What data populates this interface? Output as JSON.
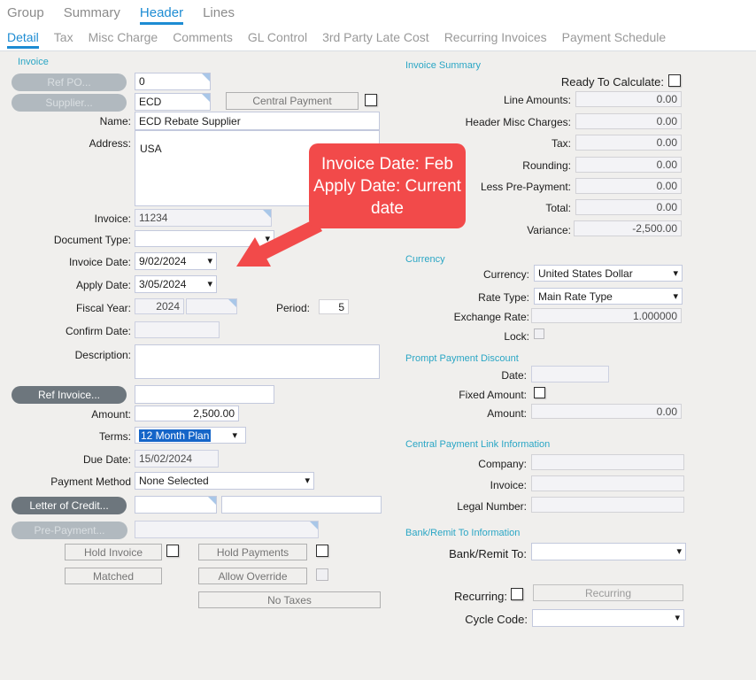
{
  "tabs_top": [
    {
      "label": "Group",
      "active": false
    },
    {
      "label": "Summary",
      "active": false
    },
    {
      "label": "Header",
      "active": true
    },
    {
      "label": "Lines",
      "active": false
    }
  ],
  "tabs_sub": [
    {
      "label": "Detail",
      "active": true
    },
    {
      "label": "Tax",
      "active": false
    },
    {
      "label": "Misc Charge",
      "active": false
    },
    {
      "label": "Comments",
      "active": false
    },
    {
      "label": "GL Control",
      "active": false
    },
    {
      "label": "3rd Party Late Cost",
      "active": false
    },
    {
      "label": "Recurring Invoices",
      "active": false
    },
    {
      "label": "Payment Schedule",
      "active": false
    }
  ],
  "invoice_group": {
    "caption": "Invoice",
    "ref_po_button": "Ref PO...",
    "ref_po_value": "0",
    "supplier_button": "Supplier...",
    "supplier_value": "ECD",
    "central_payment_button": "Central Payment",
    "name_label": "Name:",
    "name_value": "ECD Rebate Supplier",
    "address_label": "Address:",
    "address_value": "USA",
    "invoice_label": "Invoice:",
    "invoice_value": "11234",
    "document_type_label": "Document Type:",
    "document_type_value": "",
    "invoice_date_label": "Invoice Date:",
    "invoice_date_value": "9/02/2024",
    "apply_date_label": "Apply Date:",
    "apply_date_value": "3/05/2024",
    "fiscal_year_label": "Fiscal Year:",
    "fiscal_year_value": "2024",
    "fiscal_suffix_value": "",
    "period_label": "Period:",
    "period_value": "5",
    "confirm_date_label": "Confirm Date:",
    "confirm_date_value": "",
    "description_label": "Description:",
    "description_value": "",
    "ref_invoice_button": "Ref Invoice...",
    "ref_invoice_value": "",
    "amount_label": "Amount:",
    "amount_value": "2,500.00",
    "terms_label": "Terms:",
    "terms_value": "12 Month Plan",
    "due_date_label": "Due Date:",
    "due_date_value": "15/02/2024",
    "payment_method_label": "Payment Method",
    "payment_method_value": "None Selected",
    "letter_of_credit_button": "Letter of Credit...",
    "letter_of_credit_value1": "",
    "letter_of_credit_value2": "",
    "pre_payment_button": "Pre-Payment...",
    "pre_payment_value": "",
    "hold_invoice_button": "Hold Invoice",
    "hold_payments_button": "Hold Payments",
    "matched_button": "Matched",
    "allow_override_button": "Allow Override",
    "no_taxes_button": "No Taxes"
  },
  "invoice_summary": {
    "caption": "Invoice Summary",
    "ready_to_calculate_label": "Ready To Calculate:",
    "rows": [
      {
        "label": "Line Amounts:",
        "value": "0.00"
      },
      {
        "label": "Header Misc Charges:",
        "value": "0.00"
      },
      {
        "label": "Tax:",
        "value": "0.00"
      },
      {
        "label": "Rounding:",
        "value": "0.00"
      },
      {
        "label": "Less Pre-Payment:",
        "value": "0.00"
      },
      {
        "label": "Total:",
        "value": "0.00"
      },
      {
        "label": "Variance:",
        "value": "-2,500.00"
      }
    ]
  },
  "currency_group": {
    "caption": "Currency",
    "currency_label": "Currency:",
    "currency_value": "United States Dollar",
    "rate_type_label": "Rate Type:",
    "rate_type_value": "Main Rate Type",
    "exchange_rate_label": "Exchange Rate:",
    "exchange_rate_value": "1.000000",
    "lock_label": "Lock:"
  },
  "prompt_payment_discount": {
    "caption": "Prompt Payment Discount",
    "date_label": "Date:",
    "date_value": "",
    "fixed_amount_label": "Fixed Amount:",
    "amount_label": "Amount:",
    "amount_value": "0.00"
  },
  "central_payment_link": {
    "caption": "Central Payment Link Information",
    "company_label": "Company:",
    "company_value": "",
    "invoice_label": "Invoice:",
    "invoice_value": "",
    "legal_number_label": "Legal Number:",
    "legal_number_value": ""
  },
  "bank_remit": {
    "caption": "Bank/Remit To Information",
    "bank_remit_label": "Bank/Remit To:",
    "bank_remit_value": ""
  },
  "recurring_section": {
    "recurring_label": "Recurring:",
    "recurring_button": "Recurring",
    "cycle_code_label": "Cycle Code:",
    "cycle_code_value": ""
  },
  "callout": {
    "lines": [
      "Invoice Date: Feb",
      "Apply Date: Current",
      "date"
    ],
    "color": "#f24a4a"
  },
  "colors": {
    "active_tab": "#1d8cd3",
    "group_caption": "#2aa6c5",
    "selection_highlight": "#1565c8",
    "callout_red": "#f24a4a"
  }
}
